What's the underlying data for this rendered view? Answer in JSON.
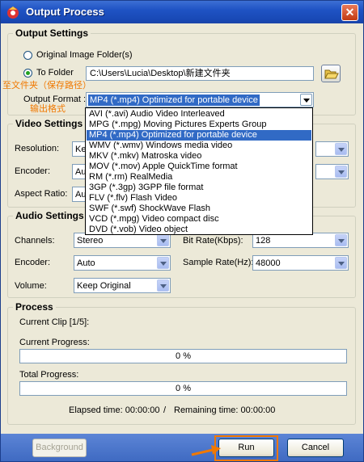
{
  "window": {
    "title": "Output Process",
    "close_symbol": "✕"
  },
  "output_settings": {
    "title": "Output Settings",
    "original_folder_label": "Original Image Folder(s)",
    "to_folder_label": "To Folder",
    "folder_path": "C:\\Users\\Lucia\\Desktop\\新建文件夹",
    "output_format_label": "Output Format :",
    "output_format_value": "MP4  (*.mp4) Optimized for portable device",
    "annotation_folder": "至文件夹（保存路径）",
    "annotation_format": "输出格式"
  },
  "format_options": [
    "AVI  (*.avi) Audio Video Interleaved",
    "MPG (*.mpg) Moving Pictures Experts Group",
    "MP4  (*.mp4) Optimized for portable device",
    "WMV  (*.wmv) Windows media video",
    "MKV  (*.mkv) Matroska video",
    "MOV  (*.mov) Apple QuickTime format",
    "RM  (*.rm) RealMedia",
    "3GP  (*.3gp) 3GPP file format",
    "FLV  (*.flv) Flash Video",
    "SWF  (*.swf) ShockWave Flash",
    "VCD  (*.mpg) Video compact disc",
    "DVD  (*.vob) Video object"
  ],
  "video_settings": {
    "title": "Video Settings",
    "resolution_label": "Resolution:",
    "resolution_value": "Ke",
    "encoder_label": "Encoder:",
    "encoder_value": "Au",
    "aspect_label": "Aspect Ratio:",
    "aspect_value": "Au"
  },
  "audio_settings": {
    "title": "Audio Settings",
    "channels_label": "Channels:",
    "channels_value": "Stereo",
    "bitrate_label": "Bit Rate(Kbps):",
    "bitrate_value": "128",
    "encoder_label": "Encoder:",
    "encoder_value": "Auto",
    "samplerate_label": "Sample Rate(Hz):",
    "samplerate_value": "48000",
    "volume_label": "Volume:",
    "volume_value": "Keep Original"
  },
  "process": {
    "title": "Process",
    "current_clip": "Current Clip [1/5]:",
    "current_progress_label": "Current Progress:",
    "current_progress_text": "0 %",
    "current_progress": 0,
    "total_progress_label": "Total Progress:",
    "total_progress_text": "0 %",
    "total_progress": 0,
    "elapsed": "Elapsed time: 00:00:00",
    "separator": "/",
    "remaining": "Remaining time: 00:00:00"
  },
  "footer": {
    "background_label": "Background",
    "run_label": "Run",
    "cancel_label": "Cancel"
  },
  "colors": {
    "annotation": "#f07800",
    "selection": "#316ac5",
    "titlebar": "#1f53c4"
  }
}
